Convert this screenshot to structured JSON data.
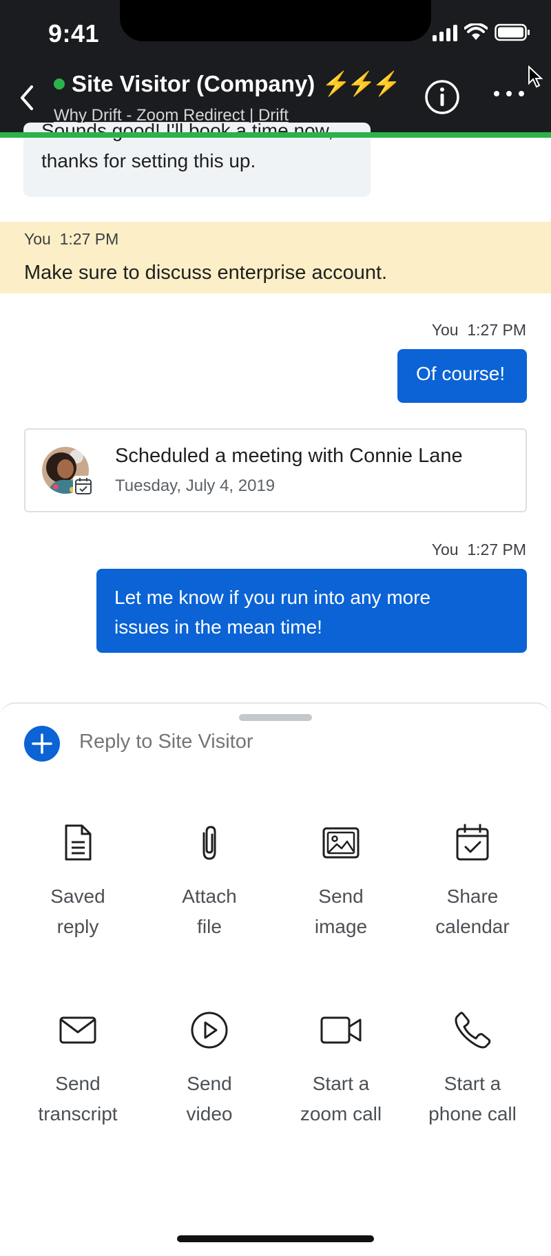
{
  "status_bar": {
    "time": "9:41"
  },
  "header": {
    "title": "Site Visitor (Company)",
    "emoji": "⚡⚡⚡",
    "subtitle": "Why Drift - Zoom Redirect | Drift"
  },
  "messages": {
    "incoming_partial": [
      "Sounds good! I'll book a time now,",
      "thanks for setting this up."
    ],
    "note": {
      "author": "You",
      "time": "1:27 PM",
      "text": "Make sure to discuss enterprise account."
    },
    "out1": {
      "author": "You",
      "time": "1:27 PM",
      "text": "Of course!"
    },
    "meeting": {
      "title": "Scheduled a meeting with Connie Lane",
      "date": "Tuesday, July 4, 2019"
    },
    "out2": {
      "author": "You",
      "time": "1:27 PM",
      "lines": [
        "Let me know if you run into any more",
        "issues in the mean time!"
      ]
    }
  },
  "composer": {
    "placeholder": "Reply to Site Visitor"
  },
  "actions": [
    {
      "icon": "document-icon",
      "lines": [
        "Saved",
        "reply"
      ]
    },
    {
      "icon": "paperclip-icon",
      "lines": [
        "Attach",
        "file"
      ]
    },
    {
      "icon": "image-icon",
      "lines": [
        "Send",
        "image"
      ]
    },
    {
      "icon": "calendar-icon",
      "lines": [
        "Share",
        "calendar"
      ]
    },
    {
      "icon": "envelope-icon",
      "lines": [
        "Send",
        "transcript"
      ]
    },
    {
      "icon": "play-icon",
      "lines": [
        "Send",
        "video"
      ]
    },
    {
      "icon": "video-camera-icon",
      "lines": [
        "Start a",
        "zoom call"
      ]
    },
    {
      "icon": "phone-icon",
      "lines": [
        "Start a",
        "phone call"
      ]
    }
  ],
  "colors": {
    "header_bg": "#1b1c1f",
    "accent_green": "#2bb24c",
    "brand_blue": "#0b63d5",
    "note_bg": "#fcefc7"
  }
}
